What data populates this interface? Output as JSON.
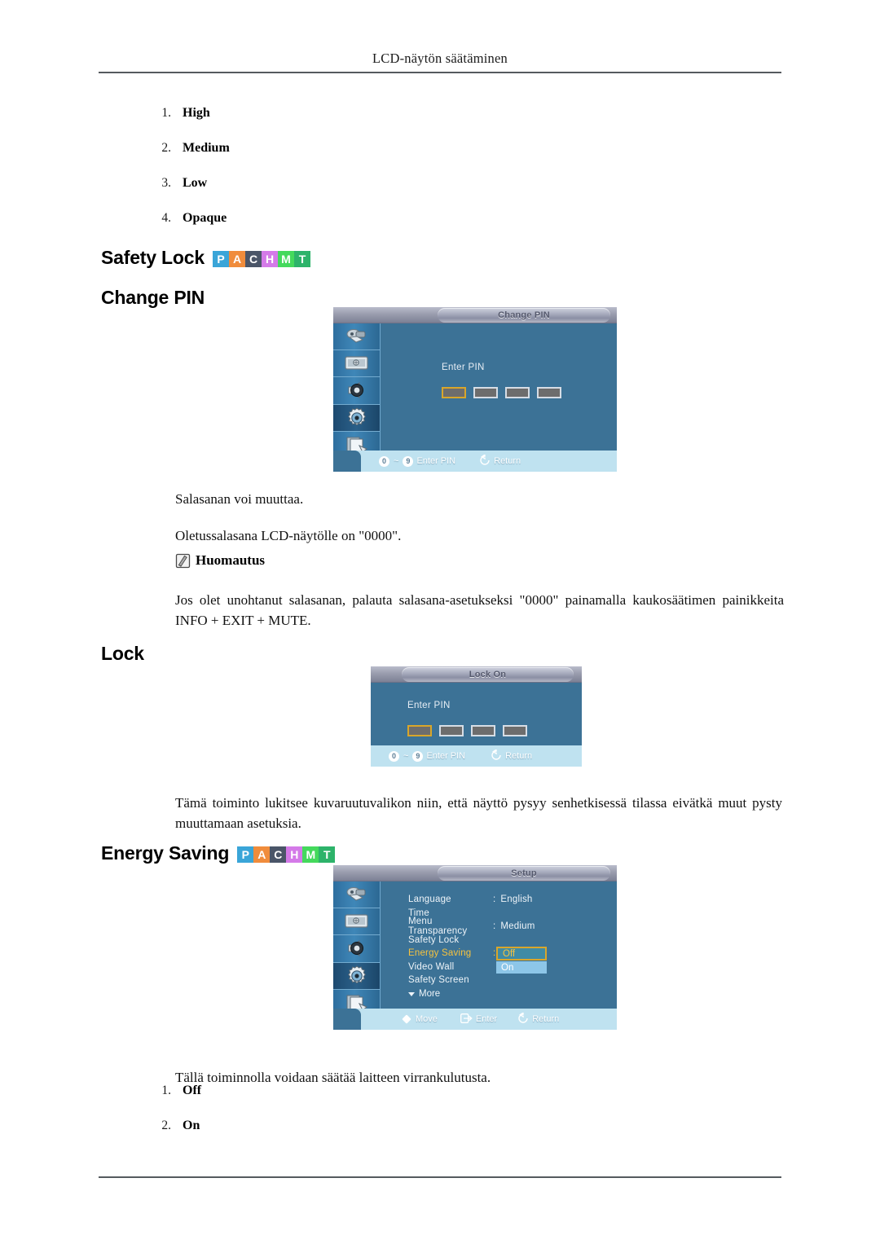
{
  "page": {
    "running_header": "LCD-näytön säätäminen"
  },
  "badge_strip": {
    "letters": [
      "P",
      "A",
      "C",
      "H",
      "M",
      "T"
    ],
    "colors": [
      "#3aa5d8",
      "#f08c3c",
      "#4a5568",
      "#d47ae8",
      "#44d95c",
      "#2db36a"
    ]
  },
  "transparency_list": {
    "items": [
      {
        "num": "1.",
        "label": "High"
      },
      {
        "num": "2.",
        "label": "Medium"
      },
      {
        "num": "3.",
        "label": "Low"
      },
      {
        "num": "4.",
        "label": "Opaque"
      }
    ]
  },
  "headings": {
    "safety_lock": "Safety Lock",
    "change_pin": "Change PIN",
    "lock": "Lock",
    "energy_saving": "Energy Saving"
  },
  "paragraphs": {
    "salasanan": "Salasanan voi muuttaa.",
    "oletus": "Oletussalasana LCD-näytölle on \"0000\".",
    "note_label": "Huomautus",
    "jos": "Jos olet unohtanut salasanan, palauta salasana-asetukseksi \"0000\" painamalla kaukosäätimen painikkeita INFO + EXIT + MUTE.",
    "tama": "Tämä toiminto lukitsee kuvaruutuvalikon niin, että näyttö pysyy senhetkisessä tilassa eivätkä muut pysty muuttamaan asetuksia.",
    "talla": "Tällä toiminnolla voidaan säätää laitteen virrankulutusta."
  },
  "energy_list": {
    "items": [
      {
        "num": "1.",
        "label": "Off"
      },
      {
        "num": "2.",
        "label": "On"
      }
    ]
  },
  "osd_change_pin": {
    "title": "Change PIN",
    "enter_pin_label": "Enter PIN",
    "pin_boxes": 4,
    "focused_box_index": 0,
    "footer": {
      "key_low": "0",
      "key_sep": "~",
      "key_high": "9",
      "enter_pin_hint": "Enter PIN",
      "return_hint": "Return"
    },
    "rail_icons": [
      "input-source-icon",
      "picture-icon",
      "sound-icon",
      "setup-gear-icon",
      "multi-control-icon"
    ],
    "rail_active_index": 3
  },
  "osd_lock": {
    "title": "Lock On",
    "enter_pin_label": "Enter PIN",
    "pin_boxes": 4,
    "focused_box_index": 0,
    "footer": {
      "key_low": "0",
      "key_sep": "~",
      "key_high": "9",
      "enter_pin_hint": "Enter PIN",
      "return_hint": "Return"
    }
  },
  "osd_setup": {
    "title": "Setup",
    "menu_items": [
      {
        "label": "Language",
        "colon": ":",
        "value": "English",
        "selected": false
      },
      {
        "label": "Time",
        "colon": "",
        "value": "",
        "selected": false
      },
      {
        "label": "Menu Transparency",
        "colon": ":",
        "value": "Medium",
        "selected": false
      },
      {
        "label": "Safety Lock",
        "colon": "",
        "value": "",
        "selected": false
      },
      {
        "label": "Energy Saving",
        "colon": ":",
        "value": "",
        "selected": true
      },
      {
        "label": "Video Wall",
        "colon": "",
        "value": "",
        "selected": false
      },
      {
        "label": "Safety Screen",
        "colon": "",
        "value": "",
        "selected": false
      }
    ],
    "more_label": "More",
    "dropdown": {
      "options": [
        "Off",
        "On"
      ],
      "selected": "Off"
    },
    "footer": {
      "move_hint": "Move",
      "enter_hint": "Enter",
      "return_hint": "Return"
    },
    "rail_icons": [
      "input-source-icon",
      "picture-icon",
      "sound-icon",
      "setup-gear-icon",
      "multi-control-icon"
    ],
    "rail_active_index": 3
  }
}
